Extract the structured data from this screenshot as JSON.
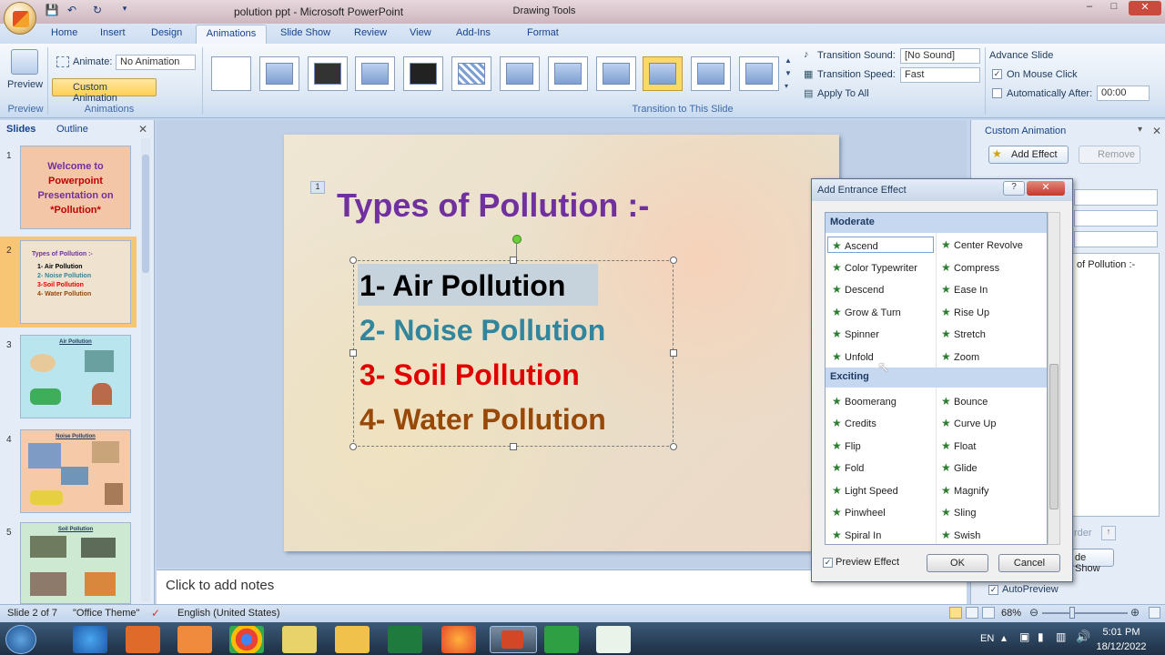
{
  "window": {
    "title": "polution ppt - Microsoft PowerPoint",
    "context_tab": "Drawing Tools"
  },
  "tabs": [
    "Home",
    "Insert",
    "Design",
    "Animations",
    "Slide Show",
    "Review",
    "View",
    "Add-Ins",
    "Format"
  ],
  "ribbon": {
    "preview_label": "Preview",
    "preview_group": "Preview",
    "animate_label": "Animate:",
    "animate_value": "No Animation",
    "custom_animation": "Custom Animation",
    "animations_group": "Animations",
    "transition_group": "Transition to This Slide",
    "transition_sound_label": "Transition Sound:",
    "transition_sound_value": "[No Sound]",
    "transition_speed_label": "Transition Speed:",
    "transition_speed_value": "Fast",
    "apply_to_all": "Apply To All",
    "advance_slide": "Advance Slide",
    "on_mouse_click": "On Mouse Click",
    "auto_after": "Automatically After:",
    "auto_after_value": "00:00"
  },
  "left_pane": {
    "tab_slides": "Slides",
    "tab_outline": "Outline",
    "slides": [
      {
        "num": "1",
        "lines": [
          "Welcome to",
          "Powerpoint",
          "Presentation on",
          "*Pollution*"
        ]
      },
      {
        "num": "2",
        "title": "Types of Pollution :-",
        "lines": [
          "1- Air Pollution",
          "2- Noise Pollution",
          "3-Soil Pollution",
          "4- Water Pollution"
        ]
      },
      {
        "num": "3",
        "title": "Air Pollution"
      },
      {
        "num": "4",
        "title": "Noise Pollution"
      },
      {
        "num": "5",
        "title": "Soil Pollution"
      }
    ]
  },
  "slide": {
    "tag": "1",
    "title": "Types of Pollution :-",
    "bullets": [
      "1- Air Pollution",
      "2- Noise Pollution",
      "3- Soil Pollution",
      "4- Water Pollution"
    ],
    "colors": [
      "#000000",
      "#31859c",
      "#e00000",
      "#984807"
    ]
  },
  "notes_placeholder": "Click to add notes",
  "right_pane": {
    "title": "Custom Animation",
    "add_effect": "Add Effect",
    "remove": "Remove",
    "list_item": "of Pollution :-",
    "slide_show": "de Show",
    "order": "rder",
    "autopreview": "AutoPreview"
  },
  "dialog": {
    "title": "Add Entrance Effect",
    "categories": {
      "moderate": "Moderate",
      "moderate_left": [
        "Ascend",
        "Color Typewriter",
        "Descend",
        "Grow & Turn",
        "Spinner",
        "Unfold"
      ],
      "moderate_right": [
        "Center Revolve",
        "Compress",
        "Ease In",
        "Rise Up",
        "Stretch",
        "Zoom"
      ],
      "exciting": "Exciting",
      "exciting_left": [
        "Boomerang",
        "Credits",
        "Flip",
        "Fold",
        "Light Speed",
        "Pinwheel",
        "Spiral In"
      ],
      "exciting_right": [
        "Bounce",
        "Curve Up",
        "Float",
        "Glide",
        "Magnify",
        "Sling",
        "Swish"
      ]
    },
    "preview_effect": "Preview Effect",
    "ok": "OK",
    "cancel": "Cancel"
  },
  "status": {
    "slide": "Slide 2 of 7",
    "theme": "\"Office Theme\"",
    "language": "English (United States)",
    "zoom": "68%"
  },
  "taskbar": {
    "lang": "EN",
    "time": "5:01 PM",
    "date": "18/12/2022"
  }
}
